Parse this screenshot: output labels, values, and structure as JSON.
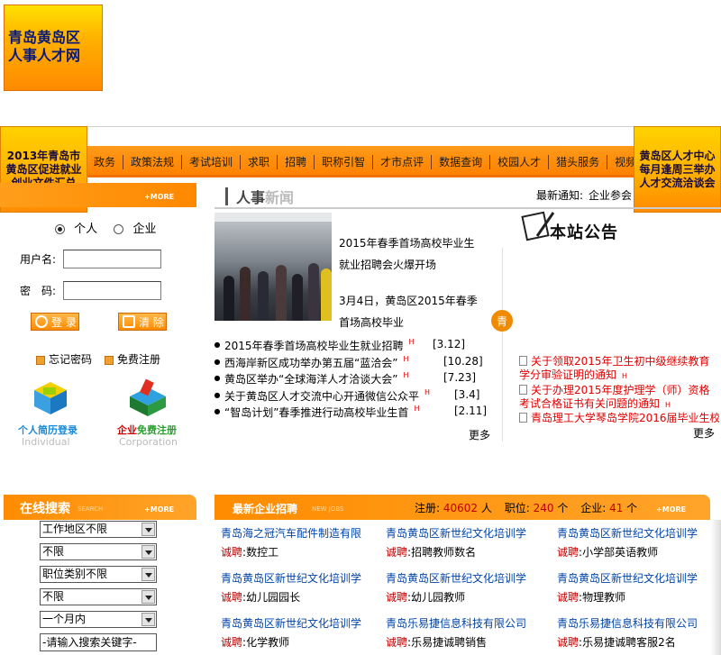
{
  "logo": {
    "line1": "青岛黄岛区",
    "line2": "人事人才网"
  },
  "nav": {
    "items": [
      "政务",
      "政策法规",
      "考试培训",
      "求职",
      "招聘",
      "职称引智",
      "才市点评",
      "数据查询",
      "校园人才",
      "猎头服务",
      "视频"
    ]
  },
  "banner_left": {
    "line1": "2013年青岛市",
    "line2": "黄岛区促进就业",
    "line3": "创业文件汇总"
  },
  "banner_right": {
    "line1": "黄岛区人才中心",
    "line2": "每月逢周三举办",
    "line3": "人才交流洽谈会"
  },
  "login": {
    "more": "+MORE",
    "type_personal": "个人",
    "type_company": "企业",
    "username_label": "用户名:",
    "password_label": "密　码:",
    "login_btn": "登 录",
    "clear_btn": "清 除",
    "forgot": "忘记密码",
    "register": "免费注册",
    "individual_cn": "个人简历登录",
    "individual_en": "Individual",
    "corporation_cn1": "企业",
    "corporation_cn2": "免费注册",
    "corporation_en": "Corporation"
  },
  "news": {
    "title_a": "人事",
    "title_b": "新闻",
    "latest_label": "最新通知:",
    "latest_text": "企业参会",
    "feature_title": "2015年春季首场高校毕业生就业招聘会火爆开场",
    "feature_desc": "3月4日，黄岛区2015年春季首场高校毕业",
    "items": [
      {
        "text": "2015年春季首场高校毕业生就业招聘",
        "date": "[3.12]"
      },
      {
        "text": "西海岸新区成功举办第五届“蓝洽会”",
        "date": "[10.28]"
      },
      {
        "text": "黄岛区举办“全球海洋人才洽谈大会”",
        "date": "[7.23]"
      },
      {
        "text": "关于黄岛区人才交流中心开通微信公众平",
        "date": "[3.4]"
      },
      {
        "text": "“智岛计划”春季推进行动高校毕业生首",
        "date": "[2.11]"
      }
    ],
    "hot_mark": "H",
    "more": "更多"
  },
  "notice": {
    "title": "本站公告",
    "badge": "青",
    "items": [
      "关于领取2015年卫生初中级继续教育学分审验证明的通知",
      "关于办理2015年度护理学（师）资格考试合格证书有关问题的通知",
      "青岛理工大学琴岛学院2016届毕业生校"
    ],
    "hot_mark": "H",
    "more": "更多"
  },
  "search": {
    "title": "在线搜索",
    "subtitle": "SEARCH",
    "more": "+MORE",
    "selects": [
      "工作地区不限",
      "不限",
      "职位类别不限",
      "不限",
      "一个月内"
    ],
    "keyword_placeholder": "-请输入搜索关键字-"
  },
  "jobs": {
    "title": "最新企业招聘",
    "subtitle": "NEW JOBS",
    "more": "+MORE",
    "reg_label": "注册:",
    "reg_count": "40602",
    "reg_unit": "人",
    "pos_label": "职位:",
    "pos_count": "240",
    "pos_unit": "个",
    "co_label": "企业:",
    "co_count": "41",
    "co_unit": "个",
    "hiring_label": "诚聘",
    "list": [
      {
        "company": "青岛海之冠汽车配件制造有限",
        "position": "数控工"
      },
      {
        "company": "青岛黄岛区新世纪文化培训学",
        "position": "招聘教师数名"
      },
      {
        "company": "青岛黄岛区新世纪文化培训学",
        "position": "小学部英语教师"
      },
      {
        "company": "青岛黄岛区新世纪文化培训学",
        "position": "幼儿园园长"
      },
      {
        "company": "青岛黄岛区新世纪文化培训学",
        "position": "幼儿园教师"
      },
      {
        "company": "青岛黄岛区新世纪文化培训学",
        "position": "物理教师"
      },
      {
        "company": "青岛黄岛区新世纪文化培训学",
        "position": "化学教师"
      },
      {
        "company": "青岛乐易捷信息科技有限公司",
        "position": "乐易捷诚聘销售"
      },
      {
        "company": "青岛乐易捷信息科技有限公司",
        "position": "乐易捷诚聘客服2名"
      }
    ]
  }
}
